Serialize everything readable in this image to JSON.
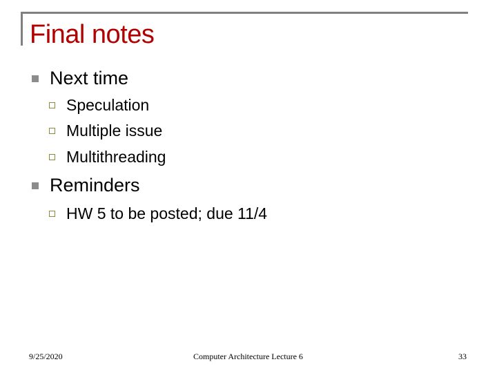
{
  "slide": {
    "title": "Final notes",
    "bullets": [
      {
        "label": "Next time",
        "sub_items": [
          "Speculation",
          "Multiple issue",
          "Multithreading"
        ]
      },
      {
        "label": "Reminders",
        "sub_items": [
          "HW 5 to be posted; due 11/4"
        ]
      }
    ]
  },
  "footer": {
    "date": "9/25/2020",
    "course": "Computer Architecture Lecture 6",
    "page_number": "33"
  },
  "colors": {
    "title": "#B00000",
    "frame": "#808080",
    "bullet_level1": "#8C8C8C",
    "bullet_level2": "#8A8A3C"
  }
}
